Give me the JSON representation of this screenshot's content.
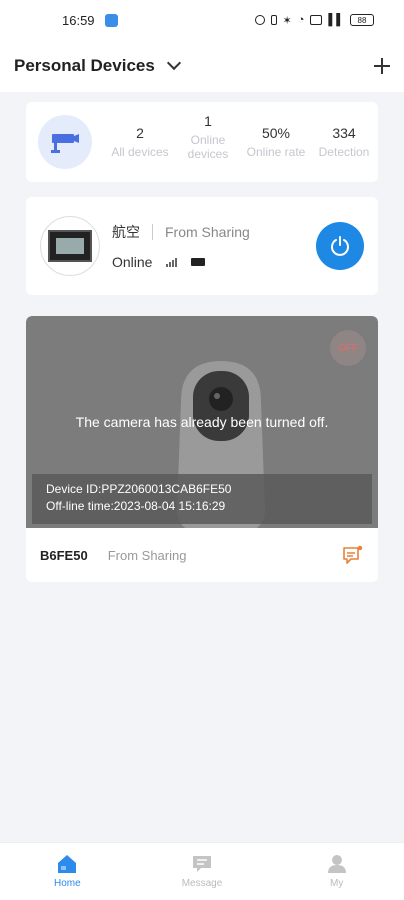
{
  "status": {
    "time": "16:59",
    "battery": "88"
  },
  "header": {
    "title": "Personal Devices"
  },
  "summary": {
    "stats": [
      {
        "value": "2",
        "label": "All devices"
      },
      {
        "value": "1",
        "label": "Online devices"
      },
      {
        "value": "50%",
        "label": "Online rate"
      },
      {
        "value": "334",
        "label": "Detection"
      }
    ]
  },
  "device": {
    "name": "航空",
    "source": "From Sharing",
    "status": "Online"
  },
  "camera": {
    "off_label": "OFF",
    "message": "The camera has already been turned off.",
    "device_id": "Device ID:PPZ2060013CAB6FE50",
    "offline_time": "Off-line time:2023-08-04 15:16:29",
    "name": "B6FE50",
    "source": "From Sharing"
  },
  "tabs": [
    {
      "label": "Home"
    },
    {
      "label": "Message"
    },
    {
      "label": "My"
    }
  ],
  "colors": {
    "accent": "#2d8bea",
    "power": "#1e88e5",
    "alert": "#e9803a"
  }
}
